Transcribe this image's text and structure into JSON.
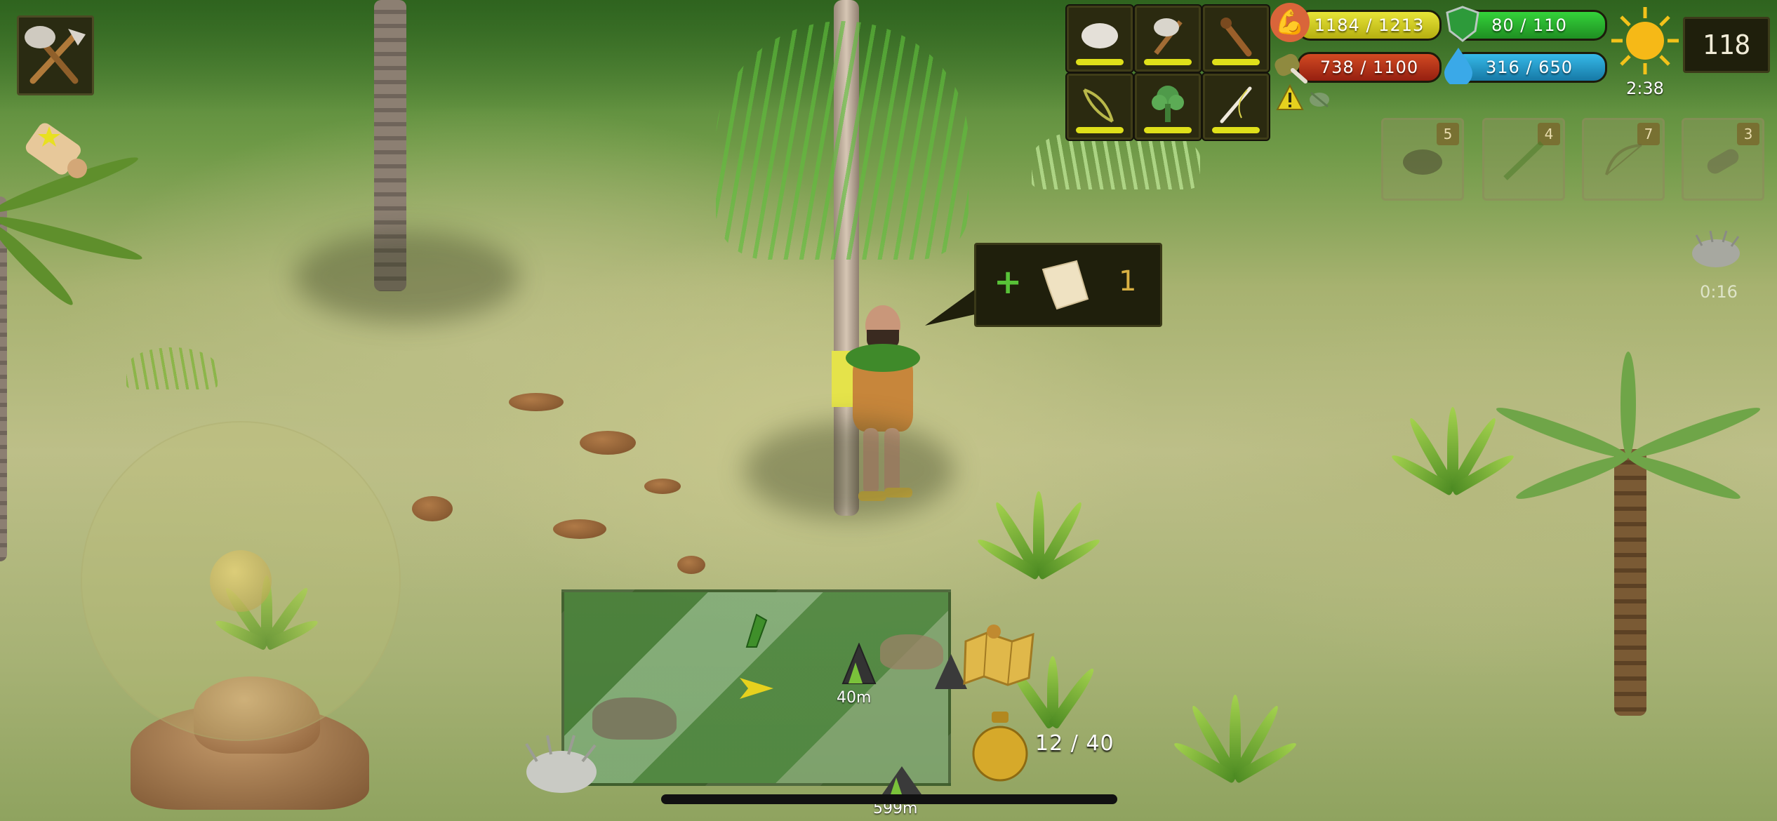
{
  "hud": {
    "tool_slots": [
      {
        "name": "stone",
        "icon": "stone-icon"
      },
      {
        "name": "stone-axe",
        "icon": "stone-axe-icon"
      },
      {
        "name": "club",
        "icon": "club-icon"
      },
      {
        "name": "sling",
        "icon": "sling-icon"
      },
      {
        "name": "broccoli",
        "icon": "plant-icon"
      },
      {
        "name": "bone-needle",
        "icon": "needle-icon"
      }
    ],
    "stats": {
      "strength": {
        "text": "1184 / 1213",
        "color": "#d7d21a",
        "icon": "strength-arm-icon"
      },
      "armor": {
        "text": "80 / 110",
        "color": "#25b52a",
        "icon": "shield-icon"
      },
      "food": {
        "text": "738 / 1100",
        "color": "#c2361b",
        "icon": "food-icon"
      },
      "water": {
        "text": "316 / 650",
        "color": "#1e9fd6",
        "icon": "water-drop-icon"
      }
    },
    "day_time": "2:38",
    "day_counter": "118",
    "warning_icon": "warning-icon",
    "inventory": [
      {
        "count": "5",
        "icon": "stone-icon"
      },
      {
        "count": "4",
        "icon": "stick-icon"
      },
      {
        "count": "7",
        "icon": "bow-icon"
      },
      {
        "count": "3",
        "icon": "log-icon"
      }
    ],
    "hedgehog_timer": "0:16",
    "pickup": {
      "count": "1",
      "icon": "paper-icon",
      "plus": "+"
    },
    "minimap": {
      "distance_near": "40m",
      "distance_far": "599m"
    },
    "bag": {
      "text": "12 / 40",
      "icon": "bag-icon"
    }
  }
}
